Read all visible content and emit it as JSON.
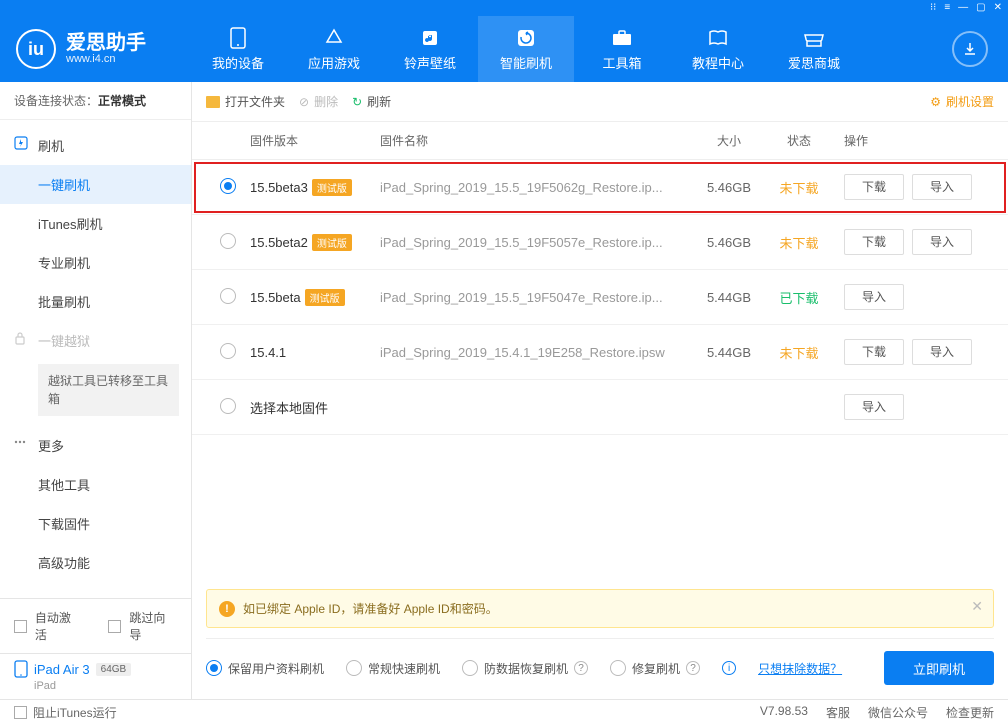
{
  "app": {
    "name": "爱思助手",
    "url": "www.i4.cn"
  },
  "nav": {
    "items": [
      {
        "label": "我的设备"
      },
      {
        "label": "应用游戏"
      },
      {
        "label": "铃声壁纸"
      },
      {
        "label": "智能刷机"
      },
      {
        "label": "工具箱"
      },
      {
        "label": "教程中心"
      },
      {
        "label": "爱思商城"
      }
    ]
  },
  "connection": {
    "label": "设备连接状态：",
    "value": "正常模式"
  },
  "sidebar": {
    "group_flash": "刷机",
    "items": {
      "oneclick": "一键刷机",
      "itunes": "iTunes刷机",
      "pro": "专业刷机",
      "batch": "批量刷机"
    },
    "jailbreak": "一键越狱",
    "jb_note": "越狱工具已转移至工具箱",
    "more": "更多",
    "more_items": {
      "other": "其他工具",
      "downloadfw": "下载固件",
      "advanced": "高级功能"
    },
    "auto_activate": "自动激活",
    "skip_guide": "跳过向导"
  },
  "device": {
    "name": "iPad Air 3",
    "storage": "64GB",
    "type": "iPad"
  },
  "toolbar": {
    "open": "打开文件夹",
    "delete": "删除",
    "refresh": "刷新",
    "settings": "刷机设置"
  },
  "table": {
    "head": {
      "ver": "固件版本",
      "name": "固件名称",
      "size": "大小",
      "status": "状态",
      "ops": "操作"
    },
    "rows": [
      {
        "ver": "15.5beta3",
        "beta": "测试版",
        "name": "iPad_Spring_2019_15.5_19F5062g_Restore.ip...",
        "size": "5.46GB",
        "status": "未下载",
        "status_class": "st-orange",
        "selected": true,
        "dl": true
      },
      {
        "ver": "15.5beta2",
        "beta": "测试版",
        "name": "iPad_Spring_2019_15.5_19F5057e_Restore.ip...",
        "size": "5.46GB",
        "status": "未下载",
        "status_class": "st-orange",
        "selected": false,
        "dl": true
      },
      {
        "ver": "15.5beta",
        "beta": "测试版",
        "name": "iPad_Spring_2019_15.5_19F5047e_Restore.ip...",
        "size": "5.44GB",
        "status": "已下载",
        "status_class": "st-green",
        "selected": false,
        "dl": false
      },
      {
        "ver": "15.4.1",
        "beta": "",
        "name": "iPad_Spring_2019_15.4.1_19E258_Restore.ipsw",
        "size": "5.44GB",
        "status": "未下载",
        "status_class": "st-orange",
        "selected": false,
        "dl": true
      }
    ],
    "local": "选择本地固件",
    "btn_download": "下载",
    "btn_import": "导入"
  },
  "warning": "如已绑定 Apple ID，请准备好 Apple ID和密码。",
  "options": {
    "keep": "保留用户资料刷机",
    "normal": "常规快速刷机",
    "antidata": "防数据恢复刷机",
    "repair": "修复刷机",
    "erase_link": "只想抹除数据？",
    "start": "立即刷机"
  },
  "statusbar": {
    "block_itunes": "阻止iTunes运行",
    "version": "V7.98.53",
    "service": "客服",
    "wechat": "微信公众号",
    "update": "检查更新"
  }
}
